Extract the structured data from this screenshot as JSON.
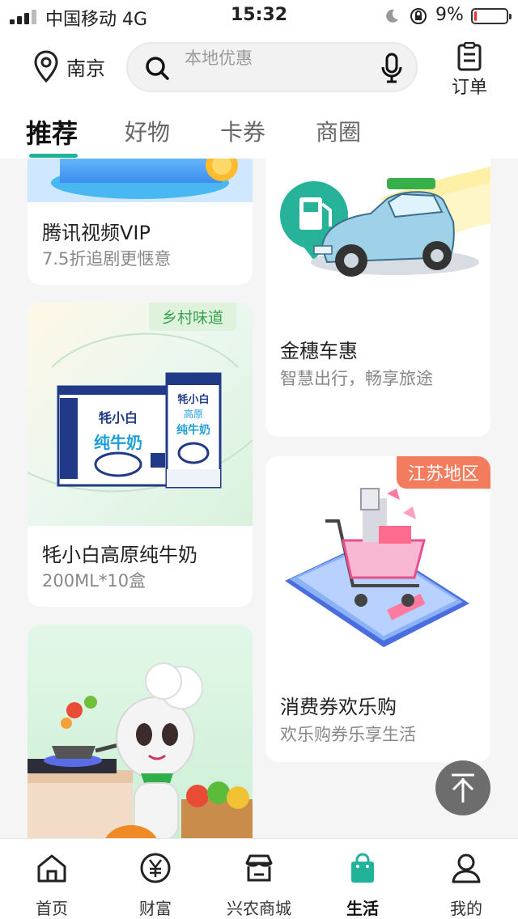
{
  "status_bar": {
    "carrier": "中国移动  4G",
    "time": "15:32",
    "battery_text": "9%",
    "battery_level": 0.09
  },
  "header": {
    "city": "南京",
    "search_placeholder": "本地优惠",
    "orders_label": "订单"
  },
  "tabs": [
    {
      "label": "推荐",
      "active": true
    },
    {
      "label": "好物",
      "active": false
    },
    {
      "label": "卡券",
      "active": false
    },
    {
      "label": "商圈",
      "active": false
    }
  ],
  "cards": {
    "tencent": {
      "title": "腾讯视频VIP",
      "subtitle": "7.5折追剧更惬意"
    },
    "car": {
      "title": "金穗车惠",
      "subtitle": "智慧出行，畅享旅途"
    },
    "milk": {
      "tag": "乡村味道",
      "title": "牦小白高原纯牛奶",
      "subtitle": "200ML*10盒",
      "box_brand": "牦小白",
      "box_line1": "高原",
      "box_line2": "纯牛奶"
    },
    "coupon": {
      "tag": "江苏地区",
      "title": "消费券欢乐购",
      "subtitle": "欢乐购券乐享生活"
    }
  },
  "bottom_nav": [
    {
      "label": "首页",
      "icon": "home-icon",
      "active": false
    },
    {
      "label": "财富",
      "icon": "yen-icon",
      "active": false
    },
    {
      "label": "兴农商城",
      "icon": "store-icon",
      "active": false
    },
    {
      "label": "生活",
      "icon": "shopping-bag-icon",
      "active": true
    },
    {
      "label": "我的",
      "icon": "user-icon",
      "active": false
    }
  ],
  "colors": {
    "accent": "#21b39a",
    "tag_red": "#f27c5d",
    "tag_green": "#3aa356"
  }
}
